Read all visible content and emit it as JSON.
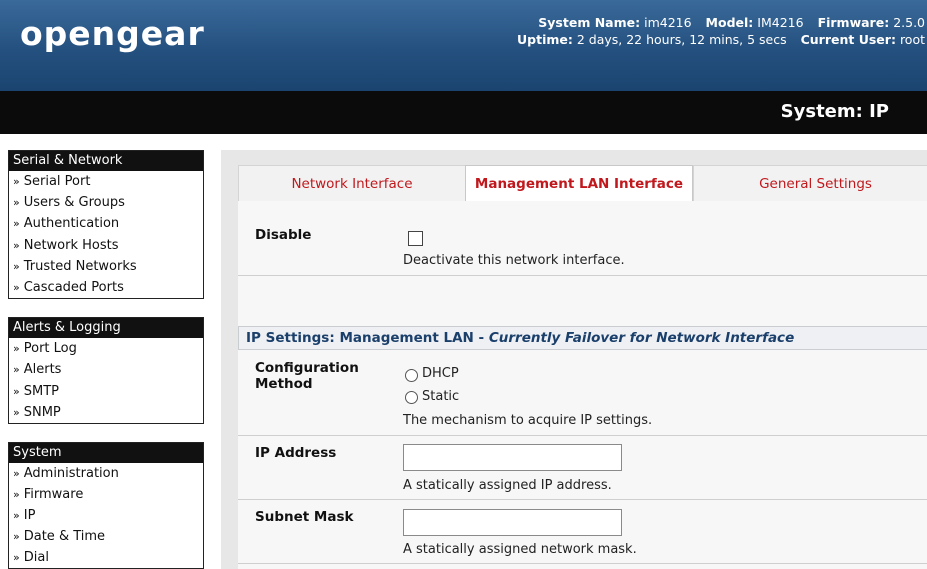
{
  "header": {
    "logo": "opengear",
    "system_name_label": "System Name:",
    "system_name": "im4216",
    "model_label": "Model:",
    "model": "IM4216",
    "firmware_label": "Firmware:",
    "firmware": "2.5.0",
    "uptime_label": "Uptime:",
    "uptime": "2 days, 22 hours, 12 mins, 5 secs",
    "current_user_label": "Current User:",
    "current_user": "root",
    "colors": {
      "header_blue": "#24507f",
      "titlebar": "#0b0b0b",
      "accent_red": "#c0181d"
    }
  },
  "page_title": "System: IP",
  "sidebar": {
    "groups": [
      {
        "title": "Serial & Network",
        "items": [
          "Serial Port",
          "Users & Groups",
          "Authentication",
          "Network Hosts",
          "Trusted Networks",
          "Cascaded Ports"
        ]
      },
      {
        "title": "Alerts & Logging",
        "items": [
          "Port Log",
          "Alerts",
          "SMTP",
          "SNMP"
        ]
      },
      {
        "title": "System",
        "items": [
          "Administration",
          "Firmware",
          "IP",
          "Date & Time",
          "Dial"
        ]
      }
    ],
    "arrow": "»"
  },
  "tabs": [
    {
      "label": "Network Interface",
      "active": false
    },
    {
      "label": "Management LAN Interface",
      "active": true
    },
    {
      "label": "General Settings",
      "active": false
    }
  ],
  "form": {
    "disable": {
      "label": "Disable",
      "checked": false,
      "hint": "Deactivate this network interface."
    },
    "ip_settings": {
      "heading": "IP Settings: Management LAN - ",
      "heading_status": "Currently Failover for Network Interface"
    },
    "config_method": {
      "label_line1": "Configuration",
      "label_line2": "Method",
      "options": [
        "DHCP",
        "Static"
      ],
      "selected": null,
      "hint": "The mechanism to acquire IP settings."
    },
    "ip_address": {
      "label": "IP Address",
      "value": "",
      "hint": "A statically assigned IP address."
    },
    "subnet_mask": {
      "label": "Subnet Mask",
      "value": "",
      "hint": "A statically assigned network mask."
    }
  }
}
